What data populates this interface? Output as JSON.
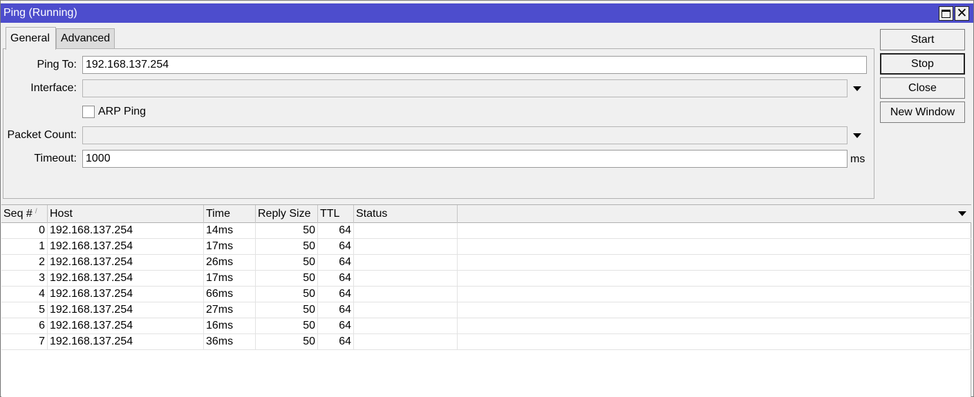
{
  "window": {
    "title": "Ping (Running)"
  },
  "tabs": [
    {
      "label": "General",
      "active": true
    },
    {
      "label": "Advanced",
      "active": false
    }
  ],
  "form": {
    "ping_to": {
      "label": "Ping To:",
      "value": "192.168.137.254"
    },
    "interface": {
      "label": "Interface:",
      "value": ""
    },
    "arp_ping": {
      "label": "ARP Ping",
      "checked": false
    },
    "packet_count": {
      "label": "Packet Count:",
      "value": ""
    },
    "timeout": {
      "label": "Timeout:",
      "value": "1000",
      "unit": "ms"
    }
  },
  "buttons": {
    "start": "Start",
    "stop": "Stop",
    "close": "Close",
    "new_window": "New Window"
  },
  "table": {
    "columns": [
      "Seq #",
      "Host",
      "Time",
      "Reply Size",
      "TTL",
      "Status"
    ],
    "sort_indicator": "/",
    "rows": [
      [
        "0",
        "192.168.137.254",
        "14ms",
        "50",
        "64",
        ""
      ],
      [
        "1",
        "192.168.137.254",
        "17ms",
        "50",
        "64",
        ""
      ],
      [
        "2",
        "192.168.137.254",
        "26ms",
        "50",
        "64",
        ""
      ],
      [
        "3",
        "192.168.137.254",
        "17ms",
        "50",
        "64",
        ""
      ],
      [
        "4",
        "192.168.137.254",
        "66ms",
        "50",
        "64",
        ""
      ],
      [
        "5",
        "192.168.137.254",
        "27ms",
        "50",
        "64",
        ""
      ],
      [
        "6",
        "192.168.137.254",
        "16ms",
        "50",
        "64",
        ""
      ],
      [
        "7",
        "192.168.137.254",
        "36ms",
        "50",
        "64",
        ""
      ]
    ]
  },
  "colors": {
    "titlebar": "#4d4dcd",
    "window_bg": "#f0f0f0"
  }
}
